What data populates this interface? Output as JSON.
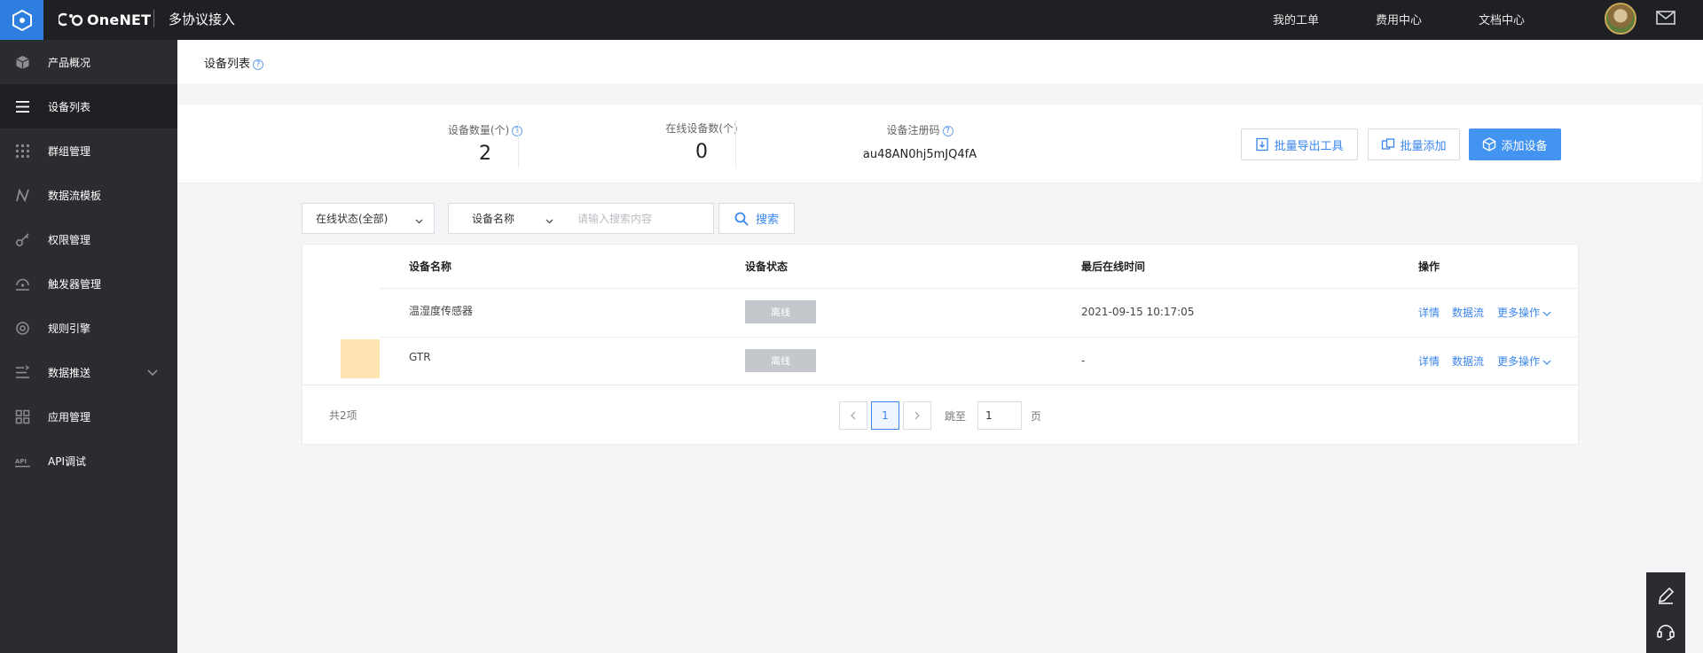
{
  "topbar": {
    "brand": "OneNET",
    "product": "多协议接入",
    "nav": [
      "我的工单",
      "费用中心",
      "文档中心"
    ],
    "icons": {
      "logo": "hexagon-logo-icon",
      "mail": "mail-icon",
      "avatar": "user-avatar"
    },
    "accent": "#2e7ee0"
  },
  "sidebar": {
    "items": [
      {
        "label": "产品概况",
        "icon": "cube-icon"
      },
      {
        "label": "设备列表",
        "icon": "list-icon",
        "active": true
      },
      {
        "label": "群组管理",
        "icon": "grid-dots-icon"
      },
      {
        "label": "数据流模板",
        "icon": "dataflow-icon"
      },
      {
        "label": "权限管理",
        "icon": "key-icon"
      },
      {
        "label": "触发器管理",
        "icon": "trigger-icon"
      },
      {
        "label": "规则引擎",
        "icon": "rule-engine-icon"
      },
      {
        "label": "数据推送",
        "icon": "push-icon",
        "expandable": true
      },
      {
        "label": "应用管理",
        "icon": "apps-icon"
      },
      {
        "label": "API调试",
        "icon": "api-icon"
      }
    ]
  },
  "page": {
    "title": "设备列表",
    "help": "?"
  },
  "stats": {
    "device_count_label": "设备数量(个)",
    "device_count": "2",
    "online_count_label": "在线设备数(个)",
    "online_count": "0",
    "reg_code_label": "设备注册码",
    "reg_code": "au48AN0hj5mJQ4fA"
  },
  "toolbar": {
    "export_label": "批量导出工具",
    "batch_add_label": "批量添加",
    "add_device_label": "添加设备"
  },
  "filter": {
    "status_select": "在线状态(全部)",
    "field_select": "设备名称",
    "search_placeholder": "请输入搜索内容",
    "search_label": "搜索"
  },
  "table": {
    "columns": [
      "设备名称",
      "设备状态",
      "最后在线时间",
      "操作"
    ],
    "rows": [
      {
        "name": "温湿度传感器",
        "status": "离线",
        "last_online": "2021-09-15 10:17:05",
        "ops": [
          "详情",
          "数据流",
          "更多操作"
        ]
      },
      {
        "name": "GTR",
        "status": "离线",
        "last_online": "-",
        "ops": [
          "详情",
          "数据流",
          "更多操作"
        ]
      }
    ]
  },
  "pagination": {
    "total": "共2项",
    "current": "1",
    "goto_label": "跳至",
    "goto_value": "1",
    "page_unit": "页"
  },
  "float_tools": {
    "icons": [
      "pen-icon",
      "headset-icon"
    ]
  }
}
